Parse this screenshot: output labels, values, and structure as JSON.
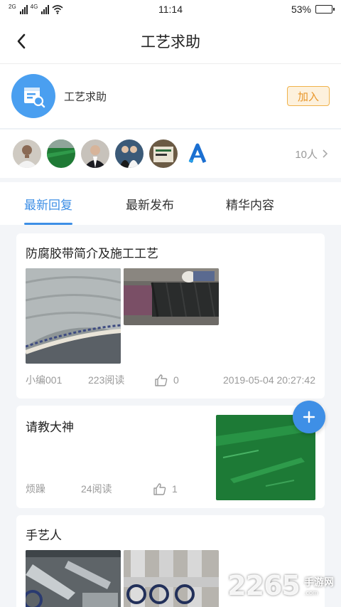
{
  "status_bar": {
    "signal_1": "2G",
    "signal_2": "4G",
    "time": "11:14",
    "battery": "53%",
    "battery_level": 0.53
  },
  "header": {
    "title": "工艺求助",
    "back_icon": "chevron-left-icon"
  },
  "group": {
    "name": "工艺求助",
    "join_label": "加入",
    "icon": "forum-search-icon",
    "accent": "#4a9ff0"
  },
  "members": {
    "count_label": "10人",
    "avatars": [
      "avatar-man-shirt",
      "avatar-green-floor",
      "avatar-man-suit",
      "avatar-couple",
      "avatar-sign",
      "avatar-logo"
    ]
  },
  "tabs": [
    {
      "label": "最新回复",
      "active": true
    },
    {
      "label": "最新发布",
      "active": false
    },
    {
      "label": "精华内容",
      "active": false
    }
  ],
  "posts": [
    {
      "title": "防腐胶带简介及施工工艺",
      "author": "小编001",
      "views": "223阅读",
      "likes": "0",
      "date": "2019-05-04 20:27:42"
    },
    {
      "title": "请教大神",
      "author": "烦躁",
      "views": "24阅读",
      "likes": "1"
    },
    {
      "title": "手艺人"
    }
  ],
  "watermark": {
    "number": "2265",
    "domain_cn": "手游网",
    "domain_en": ".com"
  },
  "colors": {
    "accent": "#3e8fe6",
    "join_border": "#f0b24a",
    "join_text": "#e8962a",
    "background": "#f3f5f8"
  }
}
